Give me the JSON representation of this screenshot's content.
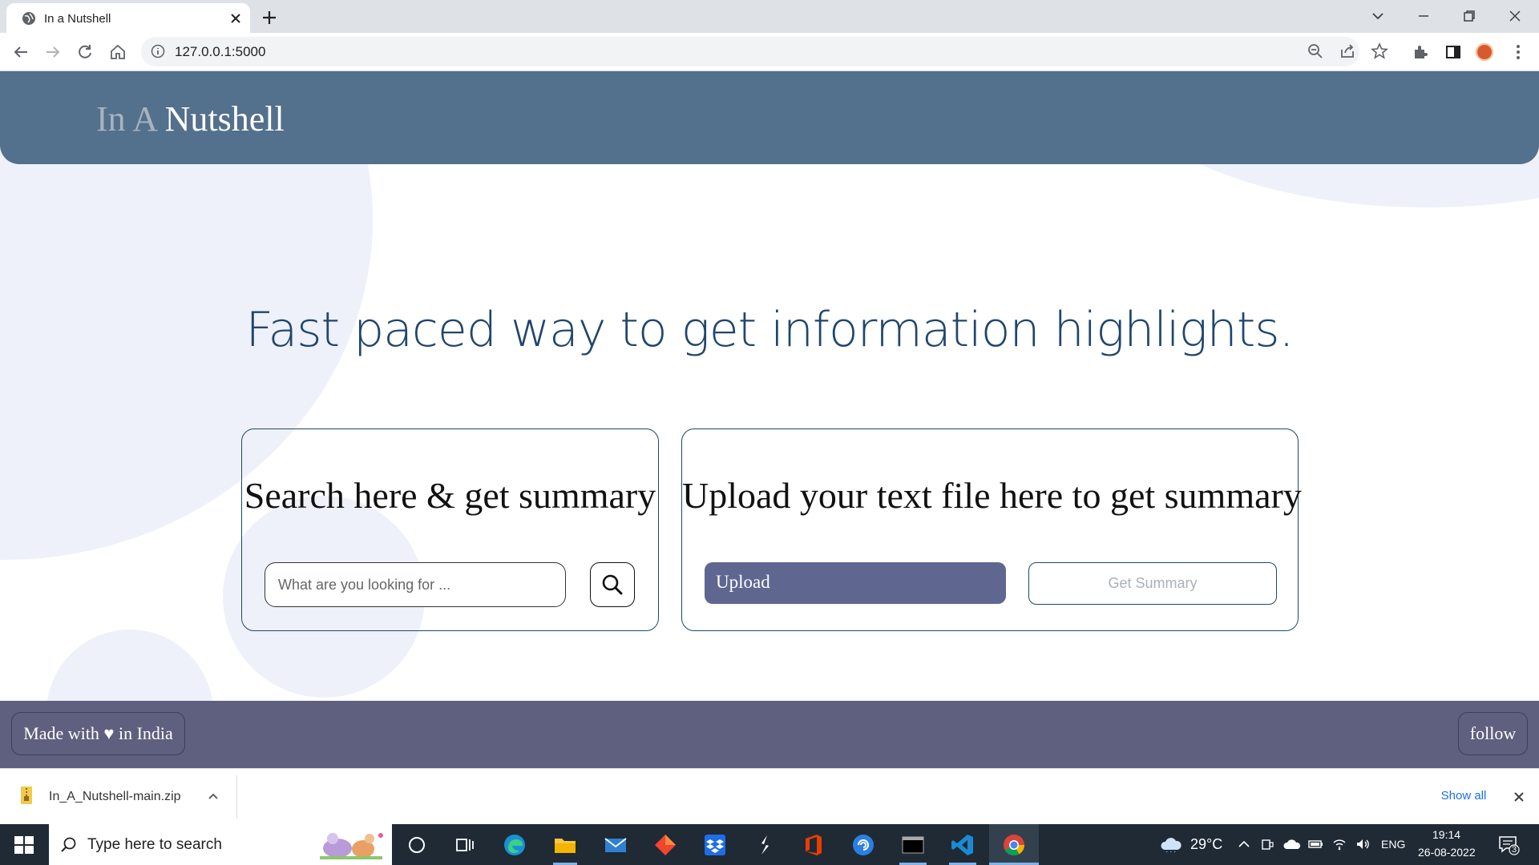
{
  "browser": {
    "tab_title": "In a Nutshell",
    "url": "127.0.0.1:5000"
  },
  "page": {
    "brand_prefix": "In A",
    "brand_main": "Nutshell",
    "hero": "Fast paced way to get information highlights.",
    "search_card": {
      "title": "Search here & get summary",
      "placeholder": "What are you looking for ..."
    },
    "upload_card": {
      "title": "Upload your text file here to get summary",
      "upload_label": "Upload",
      "get_summary_label": "Get Summary"
    },
    "footer": {
      "made_with": "Made with ♥ in India",
      "follow": "follow"
    }
  },
  "downloads": {
    "file_name": "In_A_Nutshell-main.zip",
    "show_all": "Show all"
  },
  "taskbar": {
    "search_placeholder": "Type here to search",
    "weather": "29°C",
    "language": "ENG",
    "time": "19:14",
    "date": "26-08-2022",
    "notifications": "3"
  }
}
